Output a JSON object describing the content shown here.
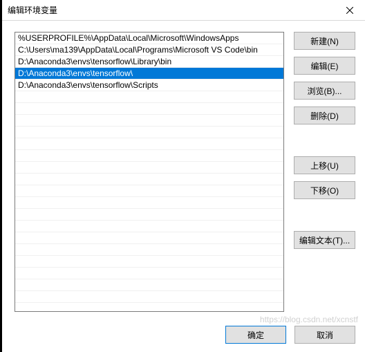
{
  "window": {
    "title": "编辑环境变量"
  },
  "list": {
    "items": [
      {
        "value": "%USERPROFILE%\\AppData\\Local\\Microsoft\\WindowsApps",
        "selected": false
      },
      {
        "value": "C:\\Users\\ma139\\AppData\\Local\\Programs\\Microsoft VS Code\\bin",
        "selected": false
      },
      {
        "value": "D:\\Anaconda3\\envs\\tensorflow\\Library\\bin",
        "selected": false
      },
      {
        "value": "D:\\Anaconda3\\envs\\tensorflow\\",
        "selected": true
      },
      {
        "value": "D:\\Anaconda3\\envs\\tensorflow\\Scripts",
        "selected": false
      }
    ]
  },
  "buttons": {
    "new": "新建(N)",
    "edit": "编辑(E)",
    "browse": "浏览(B)...",
    "delete": "删除(D)",
    "moveup": "上移(U)",
    "movedown": "下移(O)",
    "edittext": "编辑文本(T)..."
  },
  "footer": {
    "ok": "确定",
    "cancel": "取消"
  },
  "watermark": "https://blog.csdn.net/xcnstf"
}
